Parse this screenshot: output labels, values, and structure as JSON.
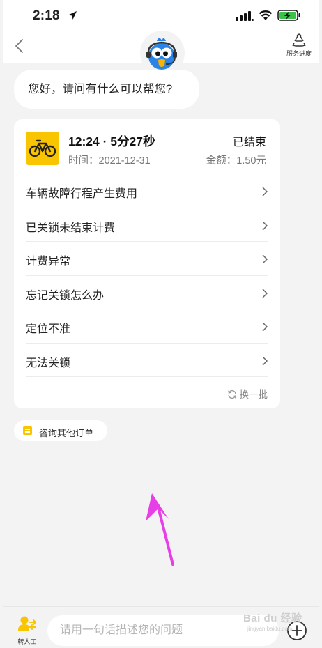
{
  "status_bar": {
    "time": "2:18"
  },
  "nav": {
    "progress_label": "服务进度"
  },
  "greeting": "您好，请问有什么可以帮您?",
  "order": {
    "title": "12:24 · 5分27秒",
    "status": "已结束",
    "time": "时间：2021-12-31",
    "amount": "金额：1.50元"
  },
  "faq": {
    "items": [
      {
        "label": "车辆故障行程产生费用"
      },
      {
        "label": "已关锁未结束计费"
      },
      {
        "label": "计费异常"
      },
      {
        "label": "忘记关锁怎么办"
      },
      {
        "label": "定位不准"
      },
      {
        "label": "无法关锁"
      }
    ],
    "refresh_label": "换一批"
  },
  "other_orders": {
    "label": "咨询其他订单"
  },
  "bottom": {
    "human_label": "转人工",
    "input_placeholder": "请用一句话描述您的问题"
  },
  "watermark": {
    "text": "Bai du 经验",
    "sub": "jingyan.baidu.com"
  },
  "colors": {
    "accent": "#f9c400",
    "annotation": "#e83ee8",
    "background": "#f3f3f3"
  },
  "icons": [
    "location-arrow-icon",
    "signal-icon",
    "wifi-icon",
    "battery-charging-icon",
    "back-chevron-icon",
    "bird-avatar-icon",
    "recycle-icon",
    "bike-icon",
    "chevron-right-icon",
    "refresh-icon",
    "document-icon",
    "person-transfer-icon",
    "plus-circle-icon"
  ]
}
